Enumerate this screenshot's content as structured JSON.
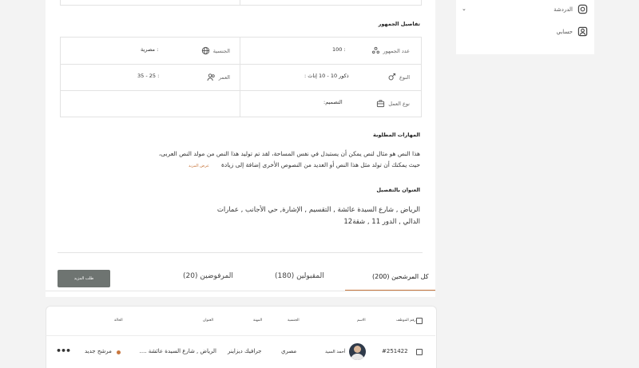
{
  "sidebar": {
    "items": [
      {
        "label": "الدردشة",
        "icon": "chat-icon"
      },
      {
        "label": "حسابي",
        "icon": "user-account-icon"
      }
    ]
  },
  "details": {
    "title": "تفاصيل الجمهور",
    "rows": [
      {
        "right_label": "عدد الجمهور",
        "right_value": "100 :",
        "left_label": "الجنسية",
        "left_value": "مصرية :"
      },
      {
        "right_label": "النوع",
        "right_value": ": ذكور 10 - 10 إناث",
        "left_label": "العمر",
        "left_value": "35 - 25 :"
      },
      {
        "right_label": "نوع العمل",
        "right_value": ":التصميم",
        "left_label": "",
        "left_value": ""
      }
    ]
  },
  "skills": {
    "title": "المهارات المطلوبة",
    "line1": "هذا النص هو مثال لنص يمكن أن يستبدل في نفس المساحة، لقد تم توليد هذا النص من مولد النص العربى،",
    "line2": "حيث يمكنك أن تولد مثل هذا النص أو العديد من النصوص الأخرى إضافة إلى زيادة",
    "more_label": "عرض المزيد"
  },
  "address": {
    "title": "العنوان بالتفصيل",
    "line1": "الرياض , شارع السيدة عائشة , التقسيم , الإشارة, حي الأجانب , عمارات",
    "line2": "الدالي , الدور 11 , شقة12"
  },
  "tabs": [
    {
      "label": "كل المرشحين (200)",
      "active": true
    },
    {
      "label": "المقبولين (180)",
      "active": false
    },
    {
      "label": "المرفوضين (20)",
      "active": false
    }
  ],
  "request_button_label": "طلب المزيد",
  "table": {
    "headers": [
      "رقم الموظف",
      "الاسم",
      "الجنسية",
      "المهنة",
      "العنوان",
      "الحالة"
    ],
    "row": {
      "id": "#251422",
      "name": "أحمد السيد",
      "nationality": "مصري",
      "profession": "جرافيك ديزاينر",
      "address": "الرياض , شارع السيدة عائشة ....",
      "status": "مرشح جديد",
      "status_color": "#c8773f"
    }
  },
  "colors": {
    "accent": "#c8773f",
    "button": "#6e7471"
  }
}
